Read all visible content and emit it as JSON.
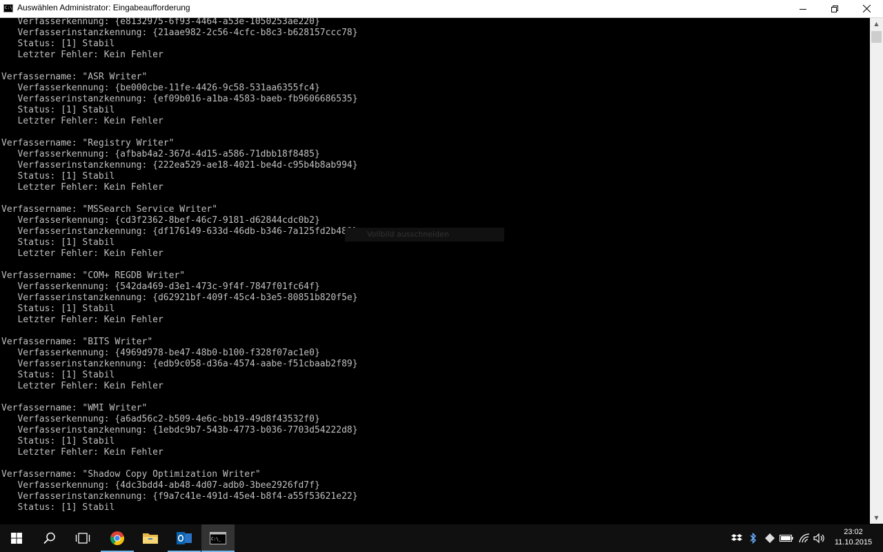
{
  "window": {
    "title": "Auswählen Administrator: Eingabeaufforderung",
    "icon": "cmd-icon",
    "controls": [
      "minimize-icon",
      "restore-icon",
      "close-icon"
    ]
  },
  "console": {
    "lines": [
      "   Verfasserkennung: {e8132975-6f93-4464-a53e-1050253ae220}",
      "   Verfasserinstanzkennung: {21aae982-2c56-4cfc-b8c3-b628157ccc78}",
      "   Status: [1] Stabil",
      "   Letzter Fehler: Kein Fehler",
      "",
      "Verfassername: \"ASR Writer\"",
      "   Verfasserkennung: {be000cbe-11fe-4426-9c58-531aa6355fc4}",
      "   Verfasserinstanzkennung: {ef09b016-a1ba-4583-baeb-fb9606686535}",
      "   Status: [1] Stabil",
      "   Letzter Fehler: Kein Fehler",
      "",
      "Verfassername: \"Registry Writer\"",
      "   Verfasserkennung: {afbab4a2-367d-4d15-a586-71dbb18f8485}",
      "   Verfasserinstanzkennung: {222ea529-ae18-4021-be4d-c95b4b8ab994}",
      "   Status: [1] Stabil",
      "   Letzter Fehler: Kein Fehler",
      "",
      "Verfassername: \"MSSearch Service Writer\"",
      "   Verfasserkennung: {cd3f2362-8bef-46c7-9181-d62844cdc0b2}",
      "   Verfasserinstanzkennung: {df176149-633d-46db-b346-7a125fd2b489}",
      "   Status: [1] Stabil",
      "   Letzter Fehler: Kein Fehler",
      "",
      "Verfassername: \"COM+ REGDB Writer\"",
      "   Verfasserkennung: {542da469-d3e1-473c-9f4f-7847f01fc64f}",
      "   Verfasserinstanzkennung: {d62921bf-409f-45c4-b3e5-80851b820f5e}",
      "   Status: [1] Stabil",
      "   Letzter Fehler: Kein Fehler",
      "",
      "Verfassername: \"BITS Writer\"",
      "   Verfasserkennung: {4969d978-be47-48b0-b100-f328f07ac1e0}",
      "   Verfasserinstanzkennung: {edb9c058-d36a-4574-aabe-f51cbaab2f89}",
      "   Status: [1] Stabil",
      "   Letzter Fehler: Kein Fehler",
      "",
      "Verfassername: \"WMI Writer\"",
      "   Verfasserkennung: {a6ad56c2-b509-4e6c-bb19-49d8f43532f0}",
      "   Verfasserinstanzkennung: {1ebdc9b7-543b-4773-b036-7703d54222d8}",
      "   Status: [1] Stabil",
      "   Letzter Fehler: Kein Fehler",
      "",
      "Verfassername: \"Shadow Copy Optimization Writer\"",
      "   Verfasserkennung: {4dc3bdd4-ab48-4d07-adb0-3bee2926fd7f}",
      "   Verfasserinstanzkennung: {f9a7c41e-491d-45e4-b8f4-a55f53621e22}",
      "   Status: [1] Stabil"
    ]
  },
  "tooltip": {
    "text": "Vollbild ausschneiden"
  },
  "taskbar": {
    "apps": [
      {
        "name": "start-button",
        "icon": "windows-icon"
      },
      {
        "name": "search-button",
        "icon": "search-icon"
      },
      {
        "name": "task-view-button",
        "icon": "task-view-icon"
      },
      {
        "name": "chrome-button",
        "icon": "chrome-icon"
      },
      {
        "name": "file-explorer-button",
        "icon": "folder-icon"
      },
      {
        "name": "outlook-button",
        "icon": "outlook-icon"
      },
      {
        "name": "command-prompt-button",
        "icon": "cmd-icon"
      }
    ],
    "tray": [
      "dropbox-icon",
      "bluetooth-icon",
      "tray-app-icon",
      "battery-icon",
      "wifi-icon",
      "volume-icon"
    ],
    "time": "23:02",
    "date": "11.10.2015"
  },
  "colors": {
    "console_bg": "#000000",
    "console_text": "#c0c0c0",
    "taskbar_bg": "#101010",
    "accent": "#76b9ed"
  }
}
